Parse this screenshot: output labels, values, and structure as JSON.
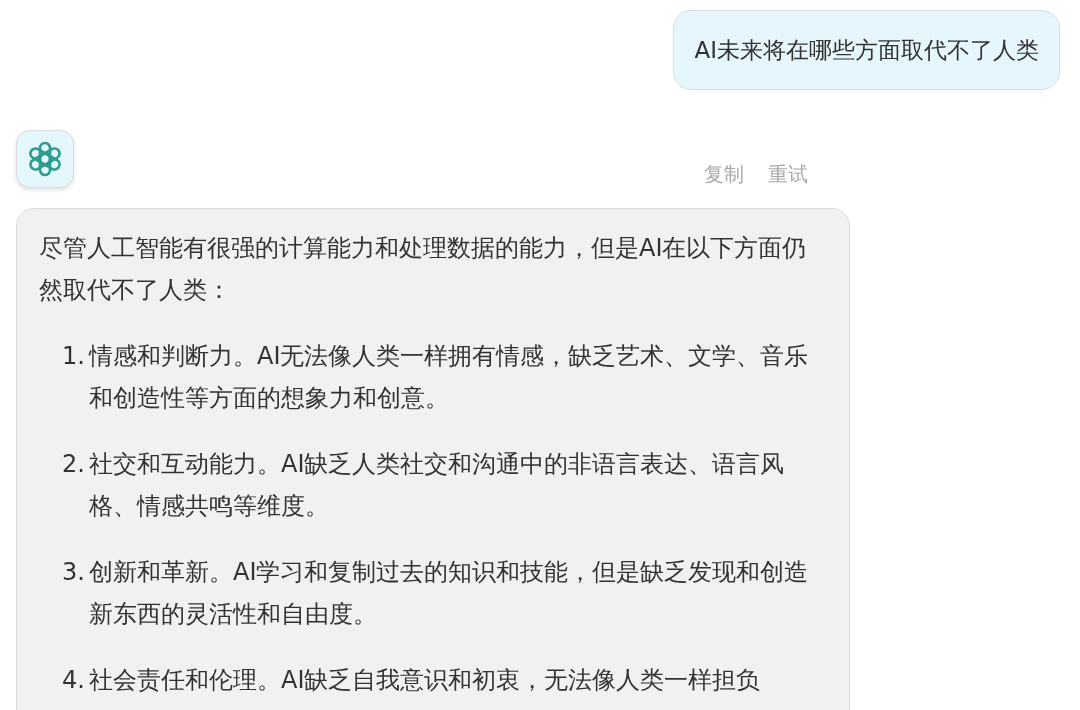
{
  "user_message": {
    "text": "AI未来将在哪些方面取代不了人类"
  },
  "assistant": {
    "actions": [
      "复制",
      "重试"
    ],
    "intro": "尽管人工智能有很强的计算能力和处理数据的能力，但是AI在以下方面仍然取代不了人类：",
    "items": [
      {
        "number": "1.",
        "text": "情感和判断力。AI无法像人类一样拥有情感，缺乏艺术、文学、音乐和创造性等方面的想象力和创意。"
      },
      {
        "number": "2.",
        "text": "社交和互动能力。AI缺乏人类社交和沟通中的非语言表达、语言风格、情感共鸣等维度。"
      },
      {
        "number": "3.",
        "text": "创新和革新。AI学习和复制过去的知识和技能，但是缺乏发现和创造新东西的灵活性和自由度。"
      },
      {
        "number": "4.",
        "text": "社会责任和伦理。AI缺乏自我意识和初衷，无法像人类一样担负"
      }
    ]
  }
}
